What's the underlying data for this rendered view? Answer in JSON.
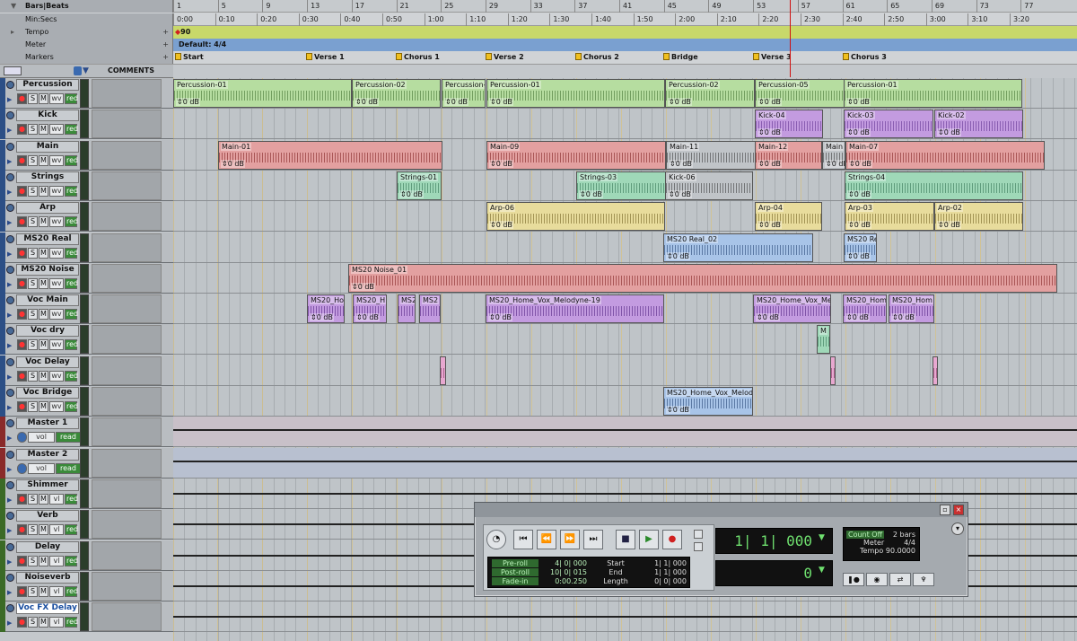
{
  "rulers": {
    "bars": {
      "label": "Bars|Beats",
      "ticks": [
        "1",
        "5",
        "9",
        "13",
        "17",
        "21",
        "25",
        "29",
        "33",
        "37",
        "41",
        "45",
        "49",
        "53",
        "57",
        "61",
        "65",
        "69",
        "73",
        "77"
      ]
    },
    "minsecs": {
      "label": "Min:Secs",
      "ticks": [
        "0:00",
        "0:10",
        "0:20",
        "0:30",
        "0:40",
        "0:50",
        "1:00",
        "1:10",
        "1:20",
        "1:30",
        "1:40",
        "1:50",
        "2:00",
        "2:10",
        "2:20",
        "2:30",
        "2:40",
        "2:50",
        "3:00",
        "3:10",
        "3:20"
      ]
    },
    "tempo": {
      "label": "Tempo",
      "value": "90"
    },
    "meter": {
      "label": "Meter",
      "value": "Default: 4/4"
    },
    "markers": {
      "label": "Markers",
      "items": [
        "Start",
        "Verse 1",
        "Chorus 1",
        "Verse 2",
        "Chorus 2",
        "Bridge",
        "Verse 3",
        "Chorus 3"
      ]
    }
  },
  "header": {
    "comments_label": "COMMENTS"
  },
  "tracks": [
    {
      "name": "Percussion",
      "type": "audio",
      "b1": "S",
      "b2": "M",
      "b3": "wv",
      "b4": "red"
    },
    {
      "name": "Kick",
      "type": "audio",
      "b1": "S",
      "b2": "M",
      "b3": "wv",
      "b4": "red"
    },
    {
      "name": "Main",
      "type": "audio",
      "b1": "S",
      "b2": "M",
      "b3": "wv",
      "b4": "red"
    },
    {
      "name": "Strings",
      "type": "audio",
      "b1": "S",
      "b2": "M",
      "b3": "wv",
      "b4": "red"
    },
    {
      "name": "Arp",
      "type": "audio",
      "b1": "S",
      "b2": "M",
      "b3": "wv",
      "b4": "red"
    },
    {
      "name": "MS20 Real",
      "type": "audio",
      "b1": "S",
      "b2": "M",
      "b3": "wv",
      "b4": "red"
    },
    {
      "name": "MS20 Noise",
      "type": "audio",
      "b1": "S",
      "b2": "M",
      "b3": "wv",
      "b4": "red"
    },
    {
      "name": "Voc Main",
      "type": "audio",
      "b1": "S",
      "b2": "M",
      "b3": "wv",
      "b4": "red"
    },
    {
      "name": "Voc dry",
      "type": "audio",
      "b1": "S",
      "b2": "M",
      "b3": "wv",
      "b4": "red"
    },
    {
      "name": "Voc Delay",
      "type": "audio",
      "b1": "S",
      "b2": "M",
      "b3": "wv",
      "b4": "red"
    },
    {
      "name": "Voc Bridge",
      "type": "audio",
      "b1": "S",
      "b2": "M",
      "b3": "wv",
      "b4": "red"
    },
    {
      "name": "Master 1",
      "type": "master",
      "b1": "vol",
      "b2": "read"
    },
    {
      "name": "Master 2",
      "type": "master",
      "b1": "vol",
      "b2": "read"
    },
    {
      "name": "Shimmer",
      "type": "aux",
      "b1": "S",
      "b2": "M",
      "b3": "vl",
      "b4": "red"
    },
    {
      "name": "Verb",
      "type": "aux",
      "b1": "S",
      "b2": "M",
      "b3": "vl",
      "b4": "red"
    },
    {
      "name": "Delay",
      "type": "aux",
      "b1": "S",
      "b2": "M",
      "b3": "vl",
      "b4": "red"
    },
    {
      "name": "Noiseverb",
      "type": "aux",
      "b1": "S",
      "b2": "M",
      "b3": "vl",
      "b4": "red"
    },
    {
      "name": "Voc FX Delay",
      "type": "aux",
      "b1": "S",
      "b2": "M",
      "b3": "vl",
      "b4": "red",
      "selected": true
    }
  ],
  "clips": [
    {
      "lane": 0,
      "name": "Percussion-01",
      "gain": "0 dB",
      "color": "#b6dda0",
      "wave": "#3a6a2a"
    },
    {
      "lane": 0,
      "name": "Percussion-02",
      "gain": "0 dB",
      "color": "#b6dda0",
      "wave": "#3a6a2a"
    },
    {
      "lane": 0,
      "name": "Percussion-",
      "gain": "0 dB",
      "color": "#b6dda0",
      "wave": "#3a6a2a"
    },
    {
      "lane": 0,
      "name": "Percussion-01",
      "gain": "0 dB",
      "color": "#b6dda0",
      "wave": "#3a6a2a"
    },
    {
      "lane": 0,
      "name": "Percussion-02",
      "gain": "0 dB",
      "color": "#b6dda0",
      "wave": "#3a6a2a"
    },
    {
      "lane": 0,
      "name": "Percussion-05",
      "gain": "0 dB",
      "color": "#b6dda0",
      "wave": "#3a6a2a"
    },
    {
      "lane": 0,
      "name": "Percussion-01",
      "gain": "0 dB",
      "color": "#b6dda0",
      "wave": "#3a6a2a"
    },
    {
      "lane": 1,
      "name": "Kick-04",
      "gain": "0 dB",
      "color": "#c39be0",
      "wave": "#5a2a8a"
    },
    {
      "lane": 1,
      "name": "Kick-03",
      "gain": "0 dB",
      "color": "#c39be0",
      "wave": "#5a2a8a"
    },
    {
      "lane": 1,
      "name": "Kick-02",
      "gain": "0 dB",
      "color": "#c39be0",
      "wave": "#5a2a8a"
    },
    {
      "lane": 2,
      "name": "Main-01",
      "gain": "0 dB",
      "color": "#e3a0a0",
      "wave": "#7a1a1a"
    },
    {
      "lane": 2,
      "name": "Main-09",
      "gain": "0 dB",
      "color": "#e3a0a0",
      "wave": "#7a1a1a"
    },
    {
      "lane": 2,
      "name": "Main-11",
      "gain": "0 dB",
      "color": "#c0c4c8",
      "wave": "#333"
    },
    {
      "lane": 2,
      "name": "Main-12",
      "gain": "0 dB",
      "color": "#e3a0a0",
      "wave": "#7a1a1a"
    },
    {
      "lane": 2,
      "name": "Main",
      "gain": "0 dB",
      "color": "#c0c4c8",
      "wave": "#333"
    },
    {
      "lane": 2,
      "name": "Main-07",
      "gain": "0 dB",
      "color": "#e3a0a0",
      "wave": "#7a1a1a"
    },
    {
      "lane": 3,
      "name": "Strings-01",
      "gain": "0 dB",
      "color": "#9fd8b8",
      "wave": "#2a6a4a"
    },
    {
      "lane": 3,
      "name": "Strings-03",
      "gain": "0 dB",
      "color": "#9fd8b8",
      "wave": "#2a6a4a"
    },
    {
      "lane": 3,
      "name": "Kick-06",
      "gain": "0 dB",
      "color": "#c0c4c8",
      "wave": "#333"
    },
    {
      "lane": 3,
      "name": "Strings-04",
      "gain": "0 dB",
      "color": "#9fd8b8",
      "wave": "#2a6a4a"
    },
    {
      "lane": 4,
      "name": "Arp-06",
      "gain": "0 dB",
      "color": "#e8dc9c",
      "wave": "#6a5a1a"
    },
    {
      "lane": 4,
      "name": "Arp-04",
      "gain": "0 dB",
      "color": "#e8dc9c",
      "wave": "#6a5a1a"
    },
    {
      "lane": 4,
      "name": "Arp-03",
      "gain": "0 dB",
      "color": "#e8dc9c",
      "wave": "#6a5a1a"
    },
    {
      "lane": 4,
      "name": "Arp-02",
      "gain": "0 dB",
      "color": "#e8dc9c",
      "wave": "#6a5a1a"
    },
    {
      "lane": 5,
      "name": "MS20 Real_02",
      "gain": "0 dB",
      "color": "#a8c4e8",
      "wave": "#1a3a6a"
    },
    {
      "lane": 5,
      "name": "MS20 Re",
      "gain": "0 dB",
      "color": "#a8c4e8",
      "wave": "#1a3a6a"
    },
    {
      "lane": 6,
      "name": "MS20 Noise_01",
      "gain": "0 dB",
      "color": "#e3a0a0",
      "wave": "#7a1a1a"
    },
    {
      "lane": 7,
      "name": "MS20_Ho",
      "gain": "0 dB",
      "color": "#c39be0",
      "wave": "#4a1a7a"
    },
    {
      "lane": 7,
      "name": "MS20_H",
      "gain": "0 dB",
      "color": "#c39be0",
      "wave": "#4a1a7a"
    },
    {
      "lane": 7,
      "name": "MS2",
      "gain": "",
      "color": "#c39be0",
      "wave": "#4a1a7a"
    },
    {
      "lane": 7,
      "name": "MS2",
      "gain": "",
      "color": "#c39be0",
      "wave": "#4a1a7a"
    },
    {
      "lane": 7,
      "name": "MS20_Home_Vox_Melodyne-19",
      "gain": "0 dB",
      "color": "#c39be0",
      "wave": "#4a1a7a"
    },
    {
      "lane": 7,
      "name": "MS20_Home_Vox_Me",
      "gain": "0 dB",
      "color": "#c39be0",
      "wave": "#4a1a7a"
    },
    {
      "lane": 7,
      "name": "MS20_Hom",
      "gain": "0 dB",
      "color": "#c39be0",
      "wave": "#4a1a7a"
    },
    {
      "lane": 7,
      "name": "MS20_Hom",
      "gain": "0 dB",
      "color": "#c39be0",
      "wave": "#4a1a7a"
    },
    {
      "lane": 8,
      "name": "M",
      "gain": "",
      "color": "#9fd8b8",
      "wave": "#2a6a4a"
    },
    {
      "lane": 9,
      "name": "",
      "gain": "",
      "color": "#e8a8d0",
      "wave": "#7a2a5a"
    },
    {
      "lane": 9,
      "name": "",
      "gain": "",
      "color": "#e8a8d0",
      "wave": "#7a2a5a"
    },
    {
      "lane": 9,
      "name": "",
      "gain": "",
      "color": "#e8a8d0",
      "wave": "#7a2a5a"
    },
    {
      "lane": 10,
      "name": "MS20_Home_Vox_Melod",
      "gain": "0 dB",
      "color": "#a8c4e8",
      "wave": "#1a3a6a"
    }
  ],
  "transport": {
    "main_counter": "1| 1| 000",
    "sub_counter": "0",
    "preroll": {
      "label": "Pre-roll",
      "value": "4| 0| 000"
    },
    "postroll": {
      "label": "Post-roll",
      "value": "10| 0| 015"
    },
    "fadein": {
      "label": "Fade-in",
      "value": "0:00.250"
    },
    "start": {
      "label": "Start",
      "value": "1| 1| 000"
    },
    "end": {
      "label": "End",
      "value": "1| 1| 000"
    },
    "length": {
      "label": "Length",
      "value": "0| 0| 000"
    },
    "countoff": {
      "label": "Count Off",
      "value": "2 bars"
    },
    "meter": {
      "label": "Meter",
      "value": "4/4"
    },
    "tempo": {
      "label": "Tempo",
      "value": "90.0000"
    }
  }
}
